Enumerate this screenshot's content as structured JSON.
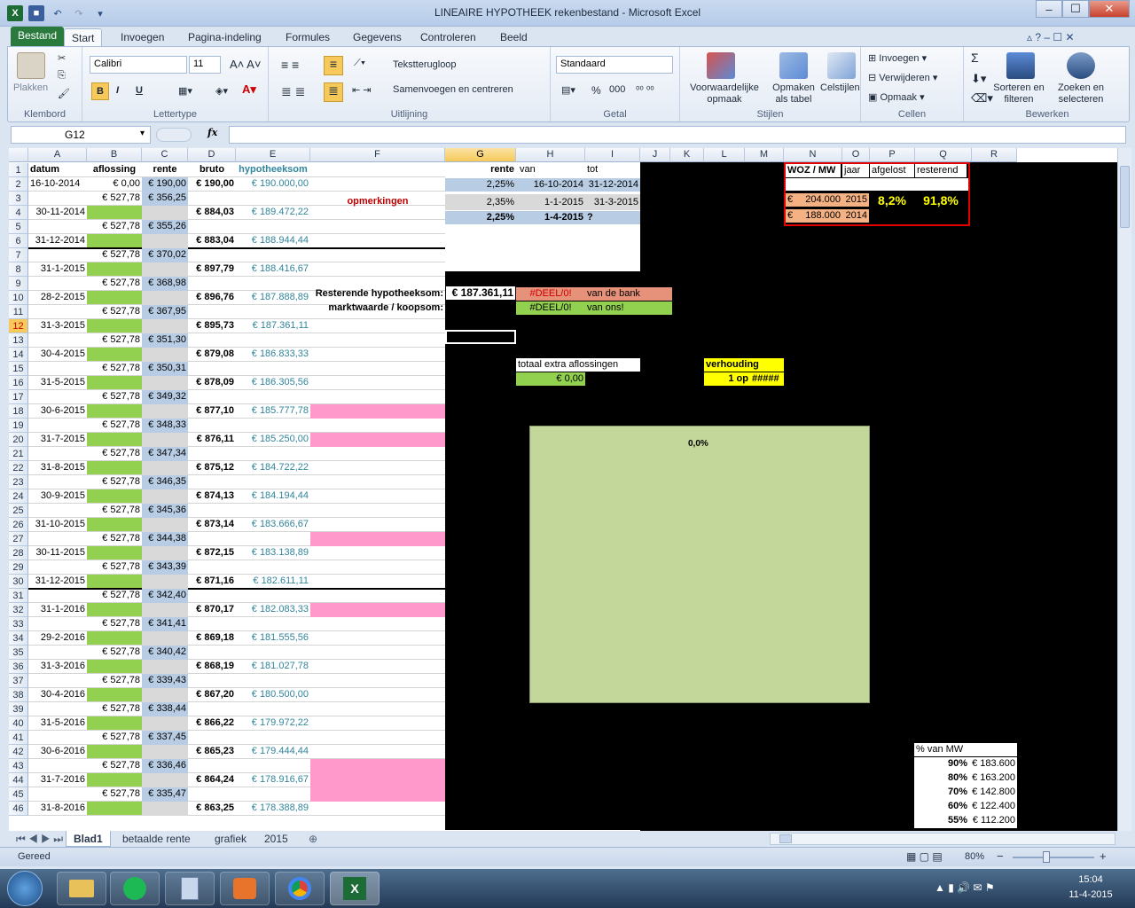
{
  "window": {
    "title": "LINEAIRE HYPOTHEEK rekenbestand - Microsoft Excel",
    "minimize": "–",
    "maximize": "☐",
    "close": "✕"
  },
  "qat": {
    "excel_icon": "X",
    "save_icon": "save-icon",
    "undo_icon": "undo-icon",
    "redo_icon": "redo-icon"
  },
  "tabs": [
    "Bestand",
    "Start",
    "Invoegen",
    "Pagina-indeling",
    "Formules",
    "Gegevens",
    "Controleren",
    "Beeld"
  ],
  "ribbon": {
    "klembord": {
      "paste_label": "Plakken",
      "group": "Klembord"
    },
    "lettertype": {
      "font": "Calibri",
      "size": "11",
      "bold": "B",
      "italic": "I",
      "underline": "U",
      "group": "Lettertype"
    },
    "uitlijning": {
      "wrap": "Tekstterugloop",
      "merge": "Samenvoegen en centreren",
      "group": "Uitlijning"
    },
    "getal": {
      "format": "Standaard",
      "percent": "%",
      "thousands": "000",
      "group": "Getal"
    },
    "stijlen": {
      "cond": "Voorwaardelijke opmaak",
      "table": "Opmaken als tabel",
      "cell": "Celstijlen",
      "group": "Stijlen"
    },
    "cellen": {
      "insert": "Invoegen",
      "delete": "Verwijderen",
      "format": "Opmaak",
      "group": "Cellen"
    },
    "bewerken": {
      "sigma": "Σ",
      "sort": "Sorteren en filteren",
      "find": "Zoeken en selecteren",
      "group": "Bewerken"
    }
  },
  "formula_bar": {
    "name_box": "G12",
    "fx": "fx",
    "formula": ""
  },
  "columns": [
    "A",
    "B",
    "C",
    "D",
    "E",
    "F",
    "G",
    "H",
    "I",
    "J",
    "K",
    "L",
    "M",
    "N",
    "O",
    "P",
    "Q",
    "R"
  ],
  "headers_row1": {
    "A": "datum",
    "B": "aflossing",
    "C": "rente",
    "D": "bruto",
    "E": "hypotheeksom"
  },
  "rate_table": {
    "headers": [
      "rente",
      "van",
      "tot"
    ],
    "rows": [
      [
        "2,25%",
        "16-10-2014",
        "31-12-2014"
      ],
      [
        "2,35%",
        "1-1-2015",
        "31-3-2015"
      ],
      [
        "2,25%",
        "1-4-2015",
        "?"
      ]
    ]
  },
  "remarks": "opmerkingen",
  "resterend_label": "Resterende hypotheeksom:",
  "resterend_value": "€ 187.361,11",
  "marktwaarde_label": "marktwaarde / koopsom:",
  "deel_bank": "#DEEL/0!",
  "van_de_bank": "van de bank",
  "deel_ons": "#DEEL/0!",
  "van_ons": "van ons!",
  "extra": {
    "label": "totaal extra aflossingen",
    "value": "€ 0,00"
  },
  "verhouding": {
    "label": "verhouding",
    "value": "1 op",
    "hash": "#####"
  },
  "chart_label": "0,0%",
  "woz": {
    "headers": [
      "WOZ / MW",
      "jaar",
      "afgelost",
      "resterend"
    ],
    "rows": [
      [
        "€",
        "204.000",
        "2015"
      ],
      [
        "€",
        "188.000",
        "2014"
      ]
    ],
    "afgelost": "8,2%",
    "resterend": "91,8%"
  },
  "mw_table": {
    "header": "% van MW",
    "rows": [
      [
        "90%",
        "€ 183.600"
      ],
      [
        "80%",
        "€ 163.200"
      ],
      [
        "70%",
        "€ 142.800"
      ],
      [
        "60%",
        "€ 122.400"
      ],
      [
        "55%",
        "€ 112.200"
      ]
    ]
  },
  "rows": [
    {
      "n": "1"
    },
    {
      "n": "2",
      "a": "16-10-2014",
      "b": "€ 0,00",
      "c": "€ 190,00",
      "d": "€ 190,00",
      "e": "€ 190.000,00"
    },
    {
      "n": "3",
      "b": "€ 527,78",
      "c": "€ 356,25"
    },
    {
      "n": "4",
      "a": "30-11-2014",
      "d": "€ 884,03",
      "e": "€ 189.472,22"
    },
    {
      "n": "5",
      "b": "€ 527,78",
      "c": "€ 355,26"
    },
    {
      "n": "6",
      "a": "31-12-2014",
      "d": "€ 883,04",
      "e": "€ 188.944,44"
    },
    {
      "n": "7",
      "b": "€ 527,78",
      "c": "€ 370,02"
    },
    {
      "n": "8",
      "a": "31-1-2015",
      "d": "€ 897,79",
      "e": "€ 188.416,67"
    },
    {
      "n": "9",
      "b": "€ 527,78",
      "c": "€ 368,98"
    },
    {
      "n": "10",
      "a": "28-2-2015",
      "d": "€ 896,76",
      "e": "€ 187.888,89"
    },
    {
      "n": "11",
      "b": "€ 527,78",
      "c": "€ 367,95"
    },
    {
      "n": "12",
      "a": "31-3-2015",
      "d": "€ 895,73",
      "e": "€ 187.361,11"
    },
    {
      "n": "13",
      "b": "€ 527,78",
      "c": "€ 351,30"
    },
    {
      "n": "14",
      "a": "30-4-2015",
      "d": "€ 879,08",
      "e": "€ 186.833,33"
    },
    {
      "n": "15",
      "b": "€ 527,78",
      "c": "€ 350,31"
    },
    {
      "n": "16",
      "a": "31-5-2015",
      "d": "€ 878,09",
      "e": "€ 186.305,56"
    },
    {
      "n": "17",
      "b": "€ 527,78",
      "c": "€ 349,32"
    },
    {
      "n": "18",
      "a": "30-6-2015",
      "d": "€ 877,10",
      "e": "€ 185.777,78"
    },
    {
      "n": "19",
      "b": "€ 527,78",
      "c": "€ 348,33"
    },
    {
      "n": "20",
      "a": "31-7-2015",
      "d": "€ 876,11",
      "e": "€ 185.250,00"
    },
    {
      "n": "21",
      "b": "€ 527,78",
      "c": "€ 347,34"
    },
    {
      "n": "22",
      "a": "31-8-2015",
      "d": "€ 875,12",
      "e": "€ 184.722,22"
    },
    {
      "n": "23",
      "b": "€ 527,78",
      "c": "€ 346,35"
    },
    {
      "n": "24",
      "a": "30-9-2015",
      "d": "€ 874,13",
      "e": "€ 184.194,44"
    },
    {
      "n": "25",
      "b": "€ 527,78",
      "c": "€ 345,36"
    },
    {
      "n": "26",
      "a": "31-10-2015",
      "d": "€ 873,14",
      "e": "€ 183.666,67"
    },
    {
      "n": "27",
      "b": "€ 527,78",
      "c": "€ 344,38"
    },
    {
      "n": "28",
      "a": "30-11-2015",
      "d": "€ 872,15",
      "e": "€ 183.138,89"
    },
    {
      "n": "29",
      "b": "€ 527,78",
      "c": "€ 343,39"
    },
    {
      "n": "30",
      "a": "31-12-2015",
      "d": "€ 871,16",
      "e": "€ 182.611,11"
    },
    {
      "n": "31",
      "b": "€ 527,78",
      "c": "€ 342,40"
    },
    {
      "n": "32",
      "a": "31-1-2016",
      "d": "€ 870,17",
      "e": "€ 182.083,33"
    },
    {
      "n": "33",
      "b": "€ 527,78",
      "c": "€ 341,41"
    },
    {
      "n": "34",
      "a": "29-2-2016",
      "d": "€ 869,18",
      "e": "€ 181.555,56"
    },
    {
      "n": "35",
      "b": "€ 527,78",
      "c": "€ 340,42"
    },
    {
      "n": "36",
      "a": "31-3-2016",
      "d": "€ 868,19",
      "e": "€ 181.027,78"
    },
    {
      "n": "37",
      "b": "€ 527,78",
      "c": "€ 339,43"
    },
    {
      "n": "38",
      "a": "30-4-2016",
      "d": "€ 867,20",
      "e": "€ 180.500,00"
    },
    {
      "n": "39",
      "b": "€ 527,78",
      "c": "€ 338,44"
    },
    {
      "n": "40",
      "a": "31-5-2016",
      "d": "€ 866,22",
      "e": "€ 179.972,22"
    },
    {
      "n": "41",
      "b": "€ 527,78",
      "c": "€ 337,45"
    },
    {
      "n": "42",
      "a": "30-6-2016",
      "d": "€ 865,23",
      "e": "€ 179.444,44"
    },
    {
      "n": "43",
      "b": "€ 527,78",
      "c": "€ 336,46"
    },
    {
      "n": "44",
      "a": "31-7-2016",
      "d": "€ 864,24",
      "e": "€ 178.916,67"
    },
    {
      "n": "45",
      "b": "€ 527,78",
      "c": "€ 335,47"
    },
    {
      "n": "46",
      "a": "31-8-2016",
      "d": "€ 863,25",
      "e": "€ 178.388,89"
    }
  ],
  "sheet_tabs": [
    "Blad1",
    "betaalde rente",
    "grafiek",
    "2015"
  ],
  "status": {
    "ready": "Gereed",
    "zoom": "80%",
    "zoom_minus": "−",
    "zoom_plus": "+"
  },
  "clock": {
    "time": "15:04",
    "date": "11-4-2015"
  },
  "colors": {
    "green": "#92d050",
    "blue": "#b8cce4",
    "pink": "#ff99cc",
    "salmon": "#e6917a",
    "yellow": "#ffff00",
    "excel_green": "#2a7a3d"
  }
}
